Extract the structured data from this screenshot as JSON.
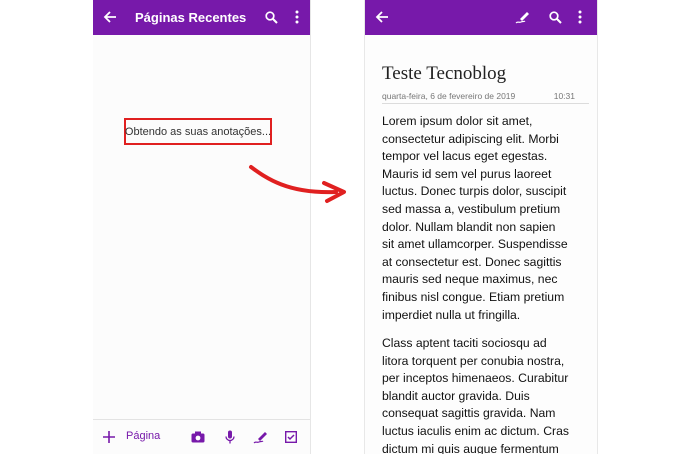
{
  "left_screen": {
    "appbar": {
      "title": "Páginas Recentes",
      "back_icon": "arrow-left-icon",
      "search_icon": "search-icon",
      "more_icon": "more-vert-icon"
    },
    "loading_message": "Obtendo as suas anotações...",
    "bottombar": {
      "add_icon": "plus-icon",
      "page_label": "Página",
      "camera_icon": "camera-icon",
      "mic_icon": "microphone-icon",
      "ink_icon": "pen-draw-icon",
      "checkbox_icon": "checkbox-icon"
    }
  },
  "annotation": {
    "arrow_color": "#e02020",
    "highlight_color": "#e02020"
  },
  "right_screen": {
    "appbar": {
      "back_icon": "arrow-left-icon",
      "ink_icon": "pen-draw-icon",
      "search_icon": "search-icon",
      "more_icon": "more-vert-icon"
    },
    "note": {
      "title": "Teste Tecnoblog",
      "date": "quarta-feira, 6 de fevereiro de 2019",
      "time": "10:31",
      "paragraph1_lines": [
        "Lorem ipsum dolor sit amet,",
        "consectetur adipiscing elit. Morbi",
        "tempor vel lacus eget egestas.",
        "Mauris id sem vel purus laoreet",
        "luctus. Donec turpis dolor, suscipit",
        "sed massa a, vestibulum pretium",
        "dolor. Nullam blandit non sapien",
        "sit amet ullamcorper. Suspendisse",
        "at consectetur est. Donec sagittis",
        "mauris sed neque maximus, nec",
        "finibus nisl congue. Etiam pretium",
        "imperdiet nulla ut fringilla."
      ],
      "paragraph2_lines": [
        "Class aptent taciti sociosqu ad",
        "litora torquent per conubia nostra,",
        "per inceptos himenaeos. Curabitur",
        "blandit auctor gravida. Duis",
        "consequat sagittis gravida. Nam",
        "luctus iaculis enim ac dictum. Cras",
        "dictum mi quis augue fermentum"
      ]
    }
  },
  "colors": {
    "brand_purple": "#7719aa",
    "text": "#111111",
    "meta": "#777777"
  }
}
